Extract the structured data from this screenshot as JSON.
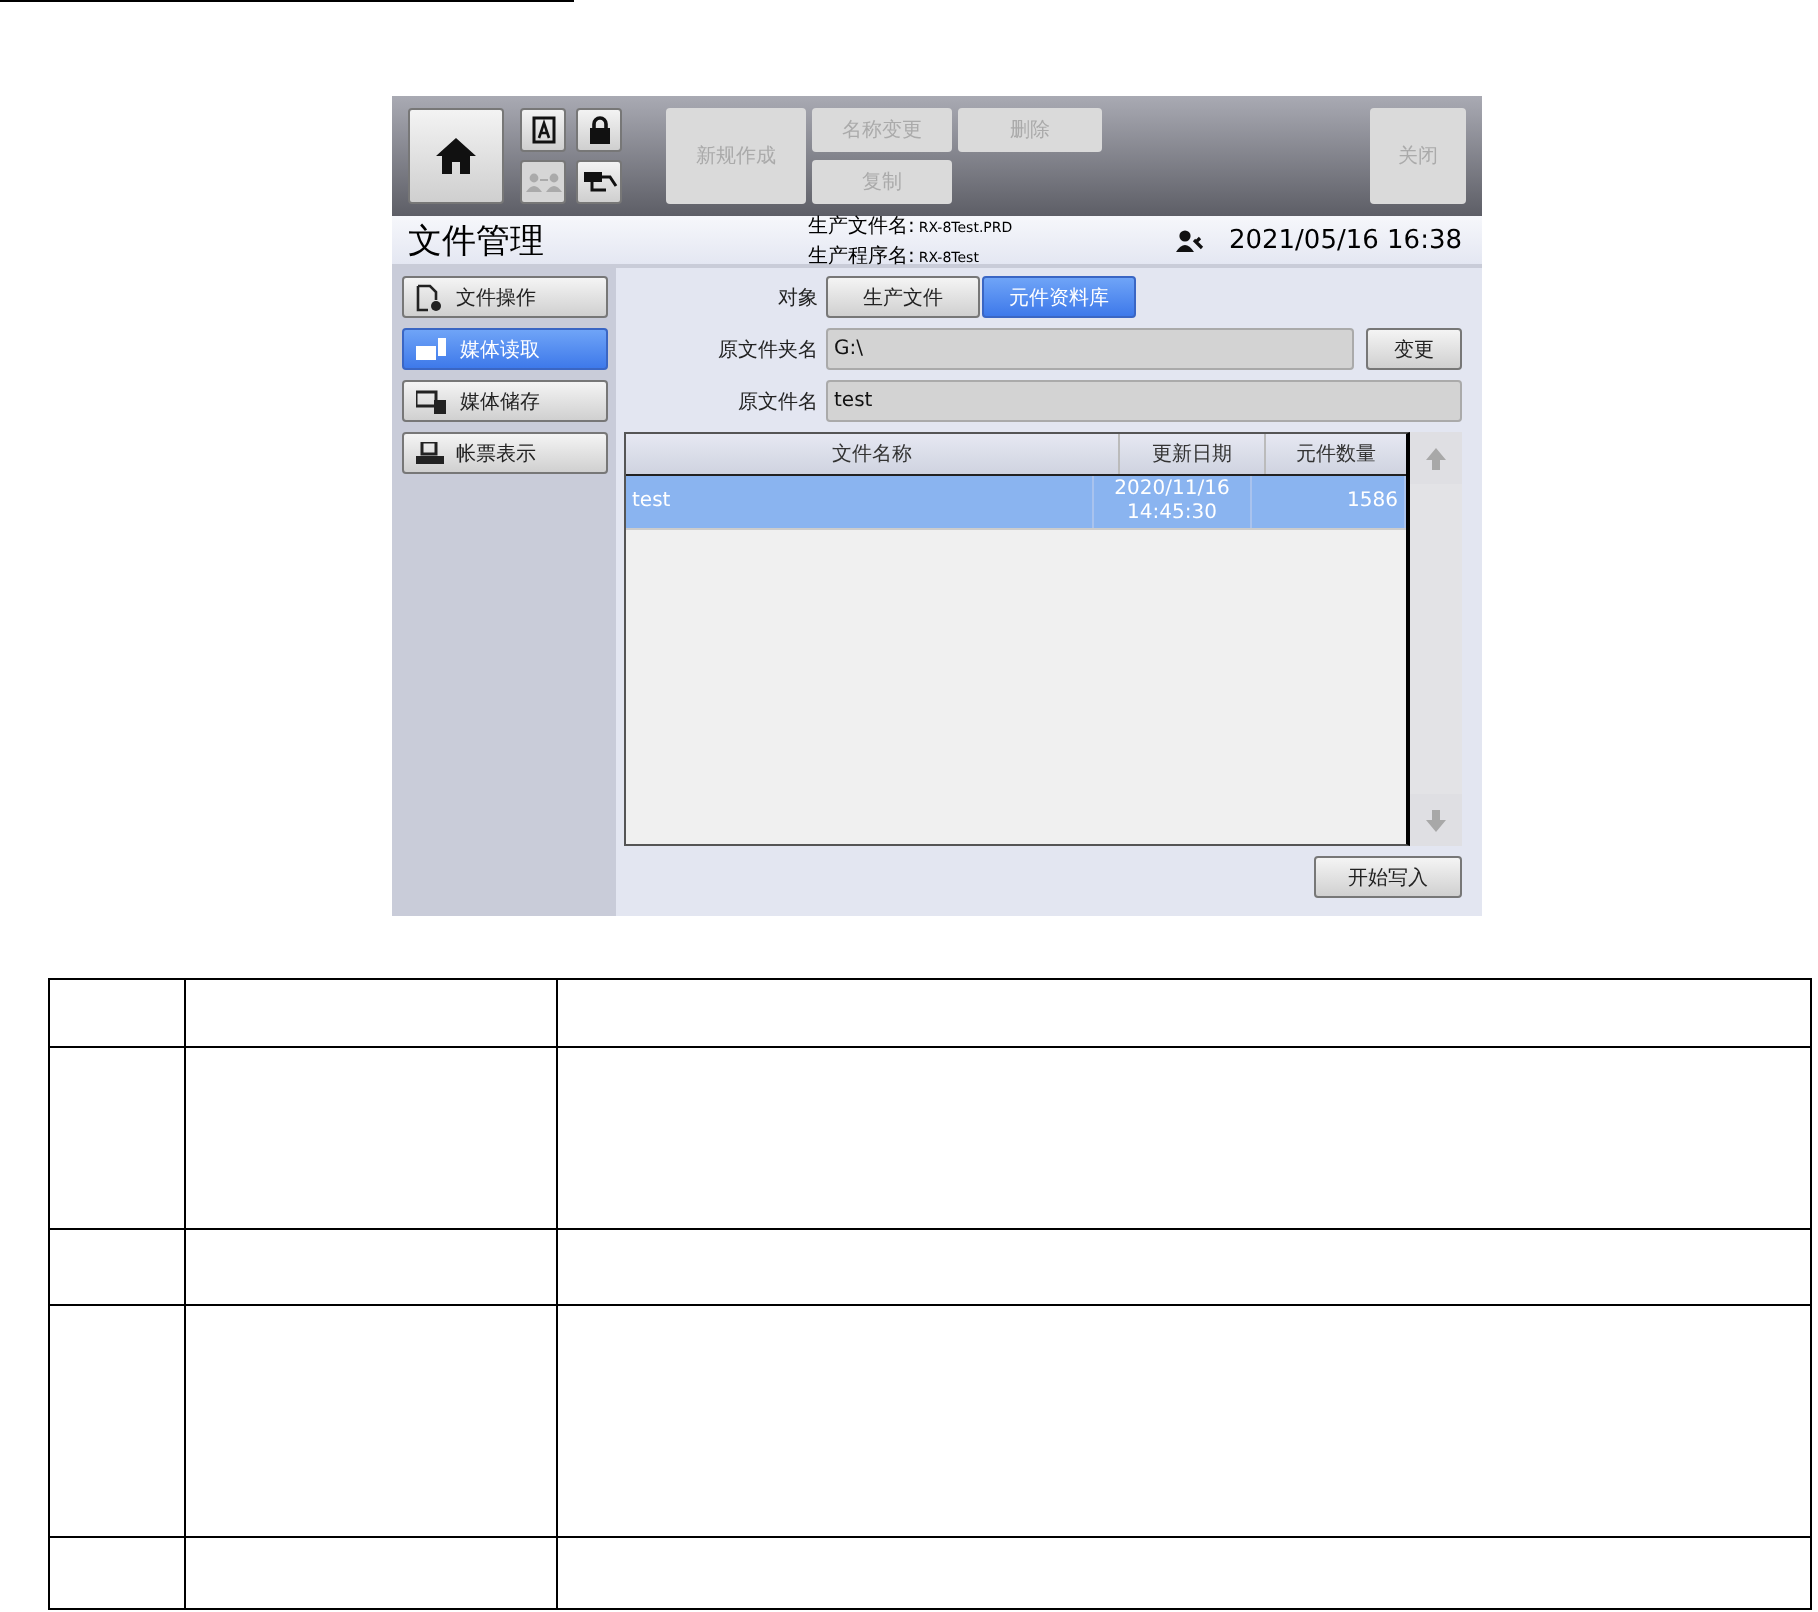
{
  "toolbar": {
    "icon_buttons": [
      {
        "kind": "home",
        "disabled": false
      },
      {
        "kind": "letter-box",
        "disabled": false
      },
      {
        "kind": "lock",
        "disabled": false
      },
      {
        "kind": "users",
        "disabled": true
      },
      {
        "kind": "plug",
        "disabled": false
      }
    ],
    "action_buttons": [
      {
        "label": "新规作成",
        "disabled": true
      },
      {
        "label": "名称变更",
        "disabled": true
      },
      {
        "label": "删除",
        "disabled": true
      },
      {
        "label": "复制",
        "disabled": true
      }
    ],
    "close_button": {
      "label": "关闭",
      "disabled": true
    }
  },
  "header": {
    "title": "文件管理",
    "info": [
      {
        "label": "生产文件名:",
        "value": "RX-8Test.PRD"
      },
      {
        "label": "生产程序名:",
        "value": "RX-8Test"
      }
    ],
    "datetime": "2021/05/16 16:38"
  },
  "sidebar": {
    "items": [
      {
        "kind": "file",
        "label": "文件操作",
        "selected": false
      },
      {
        "kind": "read",
        "label": "媒体读取",
        "selected": true
      },
      {
        "kind": "save",
        "label": "媒体储存",
        "selected": false
      },
      {
        "kind": "print",
        "label": "帐票表示",
        "selected": false
      }
    ]
  },
  "target": {
    "label": "对象",
    "tabs": [
      {
        "label": "生产文件",
        "selected": false
      },
      {
        "label": "元件资料库",
        "selected": true
      }
    ]
  },
  "folder": {
    "label": "原文件夹名",
    "value": "G:\\",
    "button": "变更"
  },
  "filename": {
    "label": "原文件名",
    "value": "test"
  },
  "table": {
    "columns": [
      "文件名称",
      "更新日期",
      "元件数量"
    ],
    "rows": [
      {
        "cells": [
          "test",
          "2020/11/16\n14:45:30",
          "1586"
        ],
        "selected": true
      }
    ]
  },
  "start_button": "开始写入"
}
